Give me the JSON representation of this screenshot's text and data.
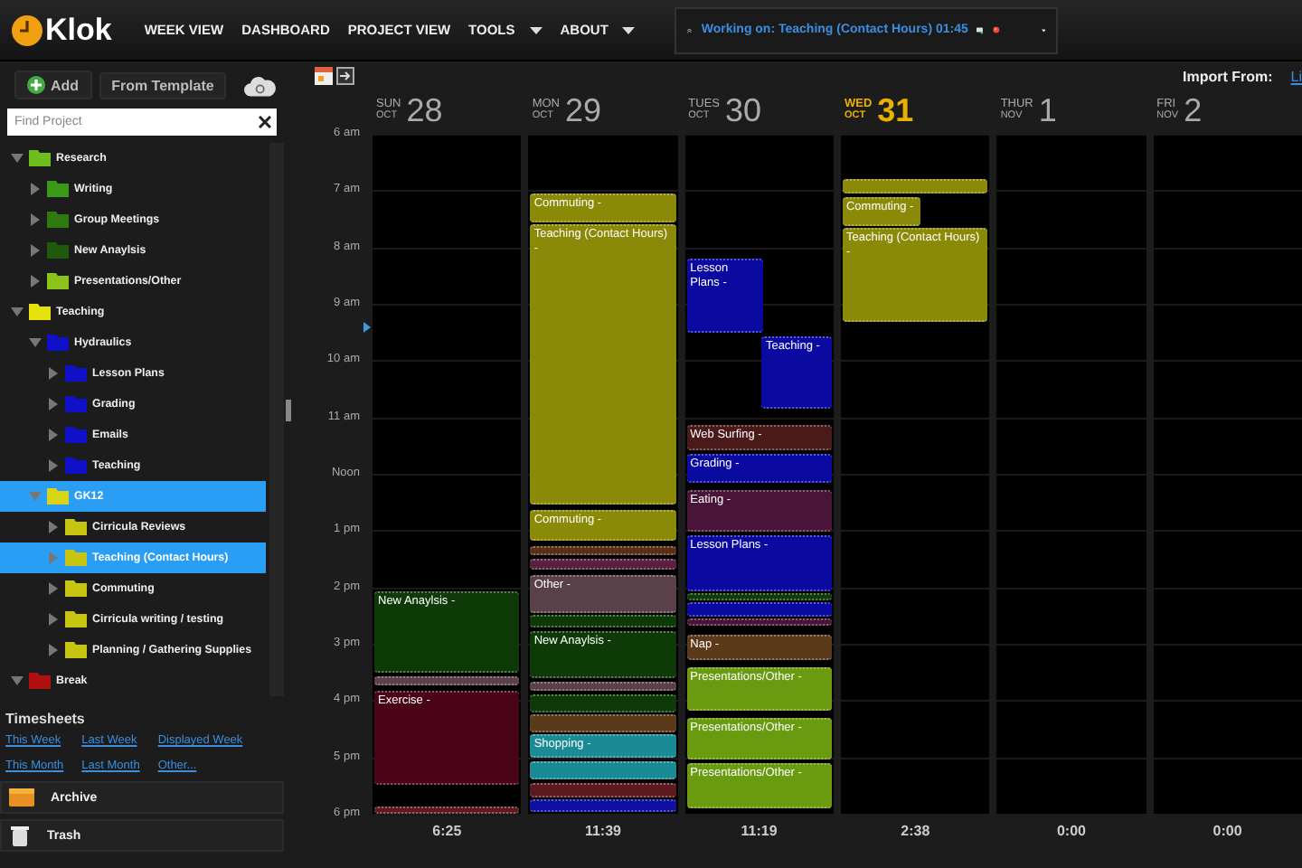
{
  "app": {
    "name": "Klok"
  },
  "nav": [
    {
      "label": "WEEK VIEW",
      "dropdown": false
    },
    {
      "label": "DASHBOARD",
      "dropdown": false
    },
    {
      "label": "PROJECT VIEW",
      "dropdown": false
    },
    {
      "label": "TOOLS",
      "dropdown": true
    },
    {
      "label": "ABOUT",
      "dropdown": true
    }
  ],
  "working_on": {
    "label": "Working on: Teaching (Contact Hours) 01:45"
  },
  "toolbar": {
    "add": "Add",
    "template": "From Template"
  },
  "search": {
    "placeholder": "Find Project"
  },
  "projects": [
    {
      "name": "Research",
      "color": "#6cbf1e",
      "expanded": true,
      "selected": false,
      "children": [
        {
          "name": "Writing",
          "color": "#3a9a18",
          "expanded": false,
          "selected": false
        },
        {
          "name": "Group Meetings",
          "color": "#2f7a10",
          "expanded": false,
          "selected": false
        },
        {
          "name": "New Anaylsis",
          "color": "#1f5a0c",
          "expanded": false,
          "selected": false
        },
        {
          "name": "Presentations/Other",
          "color": "#8cc21c",
          "expanded": false,
          "selected": false
        }
      ]
    },
    {
      "name": "Teaching",
      "color": "#e6e20e",
      "expanded": true,
      "selected": false,
      "children": [
        {
          "name": "Hydraulics",
          "color": "#1010c8",
          "expanded": true,
          "selected": false,
          "children": [
            {
              "name": "Lesson Plans",
              "color": "#1010c8",
              "expanded": false,
              "selected": false
            },
            {
              "name": "Grading",
              "color": "#1010c8",
              "expanded": false,
              "selected": false
            },
            {
              "name": "Emails",
              "color": "#1010c8",
              "expanded": false,
              "selected": false
            },
            {
              "name": "Teaching",
              "color": "#1010c8",
              "expanded": false,
              "selected": false
            }
          ]
        },
        {
          "name": "GK12",
          "color": "#d8d418",
          "expanded": true,
          "selected": true,
          "children": [
            {
              "name": "Cirricula Reviews",
              "color": "#c8c412",
              "expanded": false,
              "selected": false
            },
            {
              "name": "Teaching (Contact Hours)",
              "color": "#c8c412",
              "expanded": false,
              "selected": true
            },
            {
              "name": "Commuting",
              "color": "#c8c412",
              "expanded": false,
              "selected": false
            },
            {
              "name": "Cirricula writing / testing",
              "color": "#c8c412",
              "expanded": false,
              "selected": false
            },
            {
              "name": "Planning / Gathering Supplies",
              "color": "#c8c412",
              "expanded": false,
              "selected": false
            }
          ]
        }
      ]
    },
    {
      "name": "Break",
      "color": "#b01010",
      "expanded": true,
      "selected": false
    }
  ],
  "timesheets": {
    "title": "Timesheets",
    "links": [
      "This Week",
      "Last Week",
      "Displayed Week",
      "This Month",
      "Last Month",
      "Other..."
    ]
  },
  "archive": {
    "label": "Archive"
  },
  "trash": {
    "label": "Trash"
  },
  "calendar": {
    "import_label": "Import From:",
    "import_link": "Li",
    "hours": [
      "6 am",
      "7 am",
      "8 am",
      "9 am",
      "10 am",
      "11 am",
      "Noon",
      "1 pm",
      "2 pm",
      "3 pm",
      "4 pm",
      "5 pm",
      "6 pm"
    ],
    "days": [
      {
        "dow": "SUN",
        "month": "OCT",
        "date": "28",
        "today": false,
        "total": "6:25",
        "events": [
          {
            "title": "New Anaylsis -",
            "color": "#0e3a08"
          },
          {
            "color": "#5a4048"
          },
          {
            "title": "Exercise -",
            "color": "#4a0418"
          },
          {
            "color": "#5a1a20"
          }
        ]
      },
      {
        "dow": "MON",
        "month": "OCT",
        "date": "29",
        "today": false,
        "total": "11:39",
        "events": [
          {
            "title": "Commuting -",
            "color": "#8a8a08"
          },
          {
            "title": "Teaching (Contact Hours) -",
            "color": "#8a8a08"
          },
          {
            "title": "Commuting -",
            "color": "#8a8a08"
          },
          {
            "color": "#5a3018"
          },
          {
            "color": "#5a2040"
          },
          {
            "title": "Other -",
            "color": "#5a4048"
          },
          {
            "color": "#0e3a08"
          },
          {
            "title": "New Anaylsis -",
            "color": "#0e3a08"
          },
          {
            "color": "#5a4048"
          },
          {
            "color": "#0e3a08"
          },
          {
            "color": "#5a3a18"
          },
          {
            "title": "Shopping -",
            "color": "#1a8a94"
          },
          {
            "color": "#1a8a94"
          },
          {
            "color": "#5a1a20"
          },
          {
            "color": "#1010a0"
          }
        ]
      },
      {
        "dow": "TUES",
        "month": "OCT",
        "date": "30",
        "today": false,
        "total": "11:19",
        "events": [
          {
            "title": "Lesson Plans -",
            "color": "#0a0aa0"
          },
          {
            "title": "Teaching -",
            "color": "#0a0aa0"
          },
          {
            "title": "Web Surfing -",
            "color": "#4a1a18"
          },
          {
            "title": "Grading -",
            "color": "#0a0aa0"
          },
          {
            "title": "Eating -",
            "color": "#4a1438"
          },
          {
            "title": "Lesson Plans -",
            "color": "#0a0aa0"
          },
          {
            "color": "#0e3a08"
          },
          {
            "color": "#0a0aa0"
          },
          {
            "color": "#4a1438"
          },
          {
            "title": "Nap -",
            "color": "#5a3a18"
          },
          {
            "title": "Presentations/Other -",
            "color": "#6a9a10"
          },
          {
            "title": "Presentations/Other -",
            "color": "#6a9a10"
          },
          {
            "title": "Presentations/Other -",
            "color": "#6a9a10"
          }
        ]
      },
      {
        "dow": "WED",
        "month": "OCT",
        "date": "31",
        "today": true,
        "total": "2:38",
        "events": [
          {
            "color": "#8a8a08"
          },
          {
            "title": "Commuting -",
            "color": "#8a8a08"
          },
          {
            "title": "Teaching (Contact Hours) -",
            "color": "#8a8a08"
          }
        ]
      },
      {
        "dow": "THUR",
        "month": "NOV",
        "date": "1",
        "today": false,
        "total": "0:00"
      },
      {
        "dow": "FRI",
        "month": "NOV",
        "date": "2",
        "today": false,
        "total": "0:00"
      }
    ]
  }
}
